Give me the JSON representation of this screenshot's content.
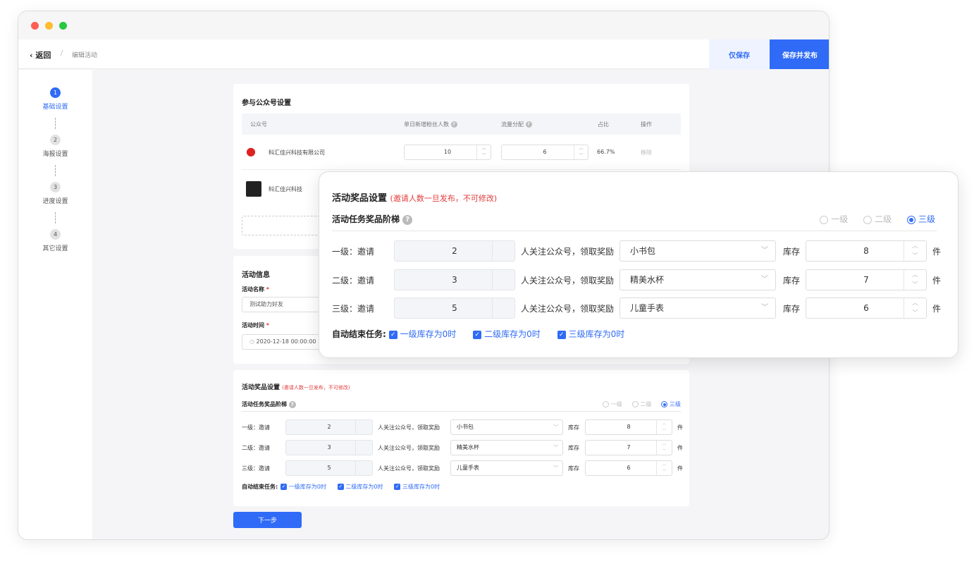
{
  "header": {
    "back": "返回",
    "separator": "/",
    "breadcrumb": "编辑活动",
    "save_only": "仅保存",
    "save_publish": "保存并发布"
  },
  "steps": [
    {
      "n": "1",
      "label": "基础设置"
    },
    {
      "n": "2",
      "label": "海报设置"
    },
    {
      "n": "3",
      "label": "进度设置"
    },
    {
      "n": "4",
      "label": "其它设置"
    }
  ],
  "accounts": {
    "title": "参与公众号设置",
    "columns": [
      "公众号",
      "单日新增粉丝人数",
      "流量分配",
      "占比",
      "操作"
    ],
    "rows": [
      {
        "name": "科汇佳兴科技有限公司",
        "daily": "10",
        "traffic": "6",
        "ratio": "66.7%",
        "action": "移除"
      },
      {
        "name": "科汇佳兴科技"
      }
    ]
  },
  "info": {
    "title": "活动信息",
    "name_label": "活动名称",
    "name_value": "测试助力好友",
    "time_label": "活动时间",
    "time_value": "2020-12-18 00:00:00",
    "required": "*"
  },
  "prize": {
    "title": "活动奖品设置",
    "note": "(邀请人数一旦发布，不可修改)",
    "ladder_label": "活动任务奖品阶梯",
    "help": "?",
    "levels": [
      "一级",
      "二级",
      "三级"
    ],
    "selected_level": "三级",
    "tiers": [
      {
        "label": "一级：邀请",
        "invite": "2",
        "mid": "人关注公众号，领取奖励",
        "reward": "小书包",
        "stock_label": "库存",
        "stock": "8",
        "unit": "件"
      },
      {
        "label": "二级：邀请",
        "invite": "3",
        "mid": "人关注公众号，领取奖励",
        "reward": "精美水杯",
        "stock_label": "库存",
        "stock": "7",
        "unit": "件"
      },
      {
        "label": "三级：邀请",
        "invite": "5",
        "mid": "人关注公众号，领取奖励",
        "reward": "儿童手表",
        "stock_label": "库存",
        "stock": "6",
        "unit": "件"
      }
    ],
    "auto_end_label": "自动结束任务:",
    "auto_end": [
      "一级库存为0时",
      "二级库存为0时",
      "三级库存为0时"
    ]
  },
  "next": "下一步",
  "colors": {
    "primary": "#2f6bf6",
    "warning": "#e33b3b",
    "light_button": "#eef3ff"
  }
}
